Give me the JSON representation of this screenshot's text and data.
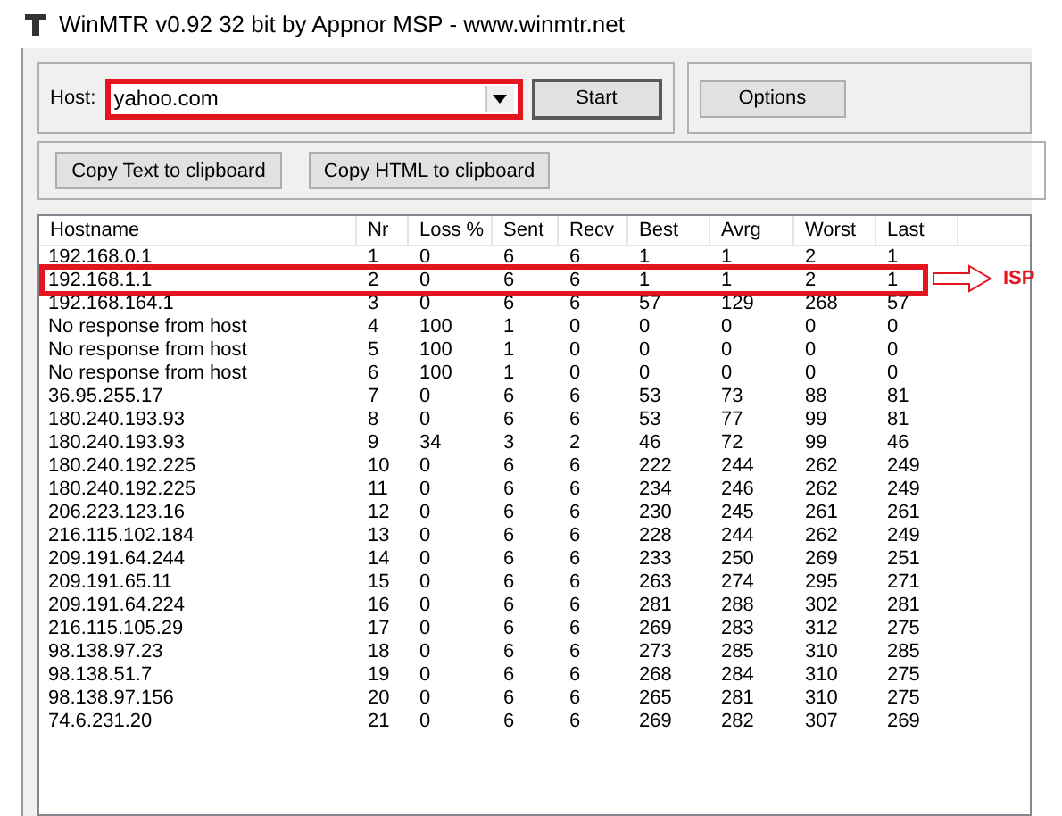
{
  "window": {
    "title": "WinMTR v0.92 32 bit by Appnor MSP - www.winmtr.net"
  },
  "host": {
    "label": "Host:",
    "value": "yahoo.com",
    "highlighted": true
  },
  "buttons": {
    "start": "Start",
    "options": "Options",
    "copy_text": "Copy Text to clipboard",
    "copy_html": "Copy HTML to clipboard"
  },
  "table": {
    "columns": [
      "Hostname",
      "Nr",
      "Loss %",
      "Sent",
      "Recv",
      "Best",
      "Avrg",
      "Worst",
      "Last"
    ],
    "rows": [
      {
        "cells": [
          "192.168.0.1",
          "1",
          "0",
          "6",
          "6",
          "1",
          "1",
          "2",
          "1"
        ],
        "highlighted": false
      },
      {
        "cells": [
          "192.168.1.1",
          "2",
          "0",
          "6",
          "6",
          "1",
          "1",
          "2",
          "1"
        ],
        "highlighted": true,
        "annotation": "ISP"
      },
      {
        "cells": [
          "192.168.164.1",
          "3",
          "0",
          "6",
          "6",
          "57",
          "129",
          "268",
          "57"
        ],
        "highlighted": false
      },
      {
        "cells": [
          "No response from host",
          "4",
          "100",
          "1",
          "0",
          "0",
          "0",
          "0",
          "0"
        ],
        "highlighted": false
      },
      {
        "cells": [
          "No response from host",
          "5",
          "100",
          "1",
          "0",
          "0",
          "0",
          "0",
          "0"
        ],
        "highlighted": false
      },
      {
        "cells": [
          "No response from host",
          "6",
          "100",
          "1",
          "0",
          "0",
          "0",
          "0",
          "0"
        ],
        "highlighted": false
      },
      {
        "cells": [
          "36.95.255.17",
          "7",
          "0",
          "6",
          "6",
          "53",
          "73",
          "88",
          "81"
        ],
        "highlighted": false
      },
      {
        "cells": [
          "180.240.193.93",
          "8",
          "0",
          "6",
          "6",
          "53",
          "77",
          "99",
          "81"
        ],
        "highlighted": false
      },
      {
        "cells": [
          "180.240.193.93",
          "9",
          "34",
          "3",
          "2",
          "46",
          "72",
          "99",
          "46"
        ],
        "highlighted": false
      },
      {
        "cells": [
          "180.240.192.225",
          "10",
          "0",
          "6",
          "6",
          "222",
          "244",
          "262",
          "249"
        ],
        "highlighted": false
      },
      {
        "cells": [
          "180.240.192.225",
          "11",
          "0",
          "6",
          "6",
          "234",
          "246",
          "262",
          "249"
        ],
        "highlighted": false
      },
      {
        "cells": [
          "206.223.123.16",
          "12",
          "0",
          "6",
          "6",
          "230",
          "245",
          "261",
          "261"
        ],
        "highlighted": false
      },
      {
        "cells": [
          "216.115.102.184",
          "13",
          "0",
          "6",
          "6",
          "228",
          "244",
          "262",
          "249"
        ],
        "highlighted": false
      },
      {
        "cells": [
          "209.191.64.244",
          "14",
          "0",
          "6",
          "6",
          "233",
          "250",
          "269",
          "251"
        ],
        "highlighted": false
      },
      {
        "cells": [
          "209.191.65.11",
          "15",
          "0",
          "6",
          "6",
          "263",
          "274",
          "295",
          "271"
        ],
        "highlighted": false
      },
      {
        "cells": [
          "209.191.64.224",
          "16",
          "0",
          "6",
          "6",
          "281",
          "288",
          "302",
          "281"
        ],
        "highlighted": false
      },
      {
        "cells": [
          "216.115.105.29",
          "17",
          "0",
          "6",
          "6",
          "269",
          "283",
          "312",
          "275"
        ],
        "highlighted": false
      },
      {
        "cells": [
          "98.138.97.23",
          "18",
          "0",
          "6",
          "6",
          "273",
          "285",
          "310",
          "285"
        ],
        "highlighted": false
      },
      {
        "cells": [
          "98.138.51.7",
          "19",
          "0",
          "6",
          "6",
          "268",
          "284",
          "310",
          "275"
        ],
        "highlighted": false
      },
      {
        "cells": [
          "98.138.97.156",
          "20",
          "0",
          "6",
          "6",
          "265",
          "281",
          "310",
          "275"
        ],
        "highlighted": false
      },
      {
        "cells": [
          "74.6.231.20",
          "21",
          "0",
          "6",
          "6",
          "269",
          "282",
          "307",
          "269"
        ],
        "highlighted": false
      }
    ]
  }
}
